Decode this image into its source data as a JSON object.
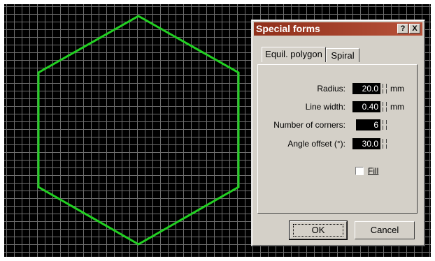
{
  "dialog": {
    "title": "Special forms",
    "help_button": "?",
    "close_button": "X",
    "tabs": [
      {
        "label": "Equil. polygon",
        "active": true
      },
      {
        "label": "Spiral",
        "active": false
      }
    ],
    "fields": {
      "radius": {
        "label": "Radius:",
        "value": "20.0",
        "unit": "mm"
      },
      "line_width": {
        "label": "Line width:",
        "value": "0.40",
        "unit": "mm"
      },
      "corners": {
        "label": "Number of corners:",
        "value": "6"
      },
      "angle_offset": {
        "label": "Angle offset (°):",
        "value": "30.0"
      }
    },
    "fill": {
      "label": "Fill",
      "checked": false
    },
    "ok_label": "OK",
    "cancel_label": "Cancel"
  },
  "canvas": {
    "shape": "hexagon",
    "stroke_color": "#22d022",
    "grid_color": "#6f6f6f",
    "background_color": "#000000"
  }
}
